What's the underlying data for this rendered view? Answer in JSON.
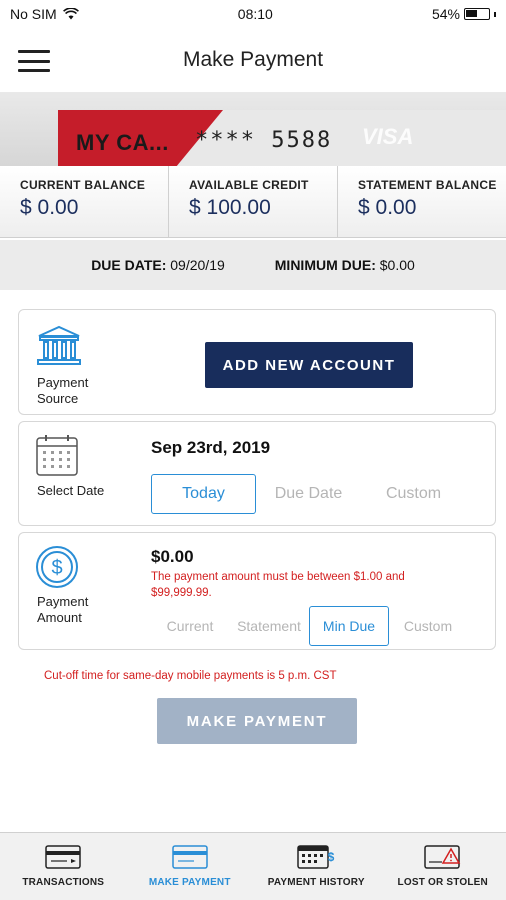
{
  "status_bar": {
    "carrier": "No SIM",
    "time": "08:10",
    "battery": "54%",
    "battery_level": 0.54
  },
  "header": {
    "title": "Make Payment"
  },
  "card": {
    "name": "MY CA...",
    "number": "**** 5588",
    "brand": "VISA"
  },
  "balances": [
    {
      "label": "CURRENT BALANCE",
      "value": "$ 0.00"
    },
    {
      "label": "AVAILABLE CREDIT",
      "value": "$ 100.00"
    },
    {
      "label": "STATEMENT BALANCE",
      "value": "$ 0.00"
    }
  ],
  "due": {
    "date_label": "DUE DATE:",
    "date_value": "09/20/19",
    "min_label": "MINIMUM DUE:",
    "min_value": "$0.00"
  },
  "payment_source": {
    "label_1": "Payment",
    "label_2": "Source",
    "button": "ADD NEW ACCOUNT"
  },
  "select_date": {
    "label": "Select Date",
    "value": "Sep 23rd, 2019",
    "options": [
      "Today",
      "Due Date",
      "Custom"
    ],
    "selected": "Today"
  },
  "payment_amount": {
    "label_1": "Payment",
    "label_2": "Amount",
    "value": "$0.00",
    "message": "The payment amount must be between $1.00 and $99,999.99.",
    "options": [
      "Current",
      "Statement",
      "Min Due",
      "Custom"
    ],
    "selected": "Min Due"
  },
  "cutoff_text": "Cut-off time for same-day mobile payments is 5 p.m. CST",
  "make_payment_button": "MAKE PAYMENT",
  "tabs": [
    {
      "label": "TRANSACTIONS",
      "icon": "transactions-card-icon"
    },
    {
      "label": "MAKE PAYMENT",
      "icon": "make-payment-card-icon",
      "active": true
    },
    {
      "label": "PAYMENT HISTORY",
      "icon": "payment-history-icon"
    },
    {
      "label": "LOST OR STOLEN",
      "icon": "lost-stolen-card-icon"
    }
  ],
  "colors": {
    "navy": "#182d5c",
    "accent_blue": "#2a8ed6",
    "error_red": "#d32020",
    "card_red": "#c51d2a",
    "disabled_button": "#a2b2c6"
  }
}
